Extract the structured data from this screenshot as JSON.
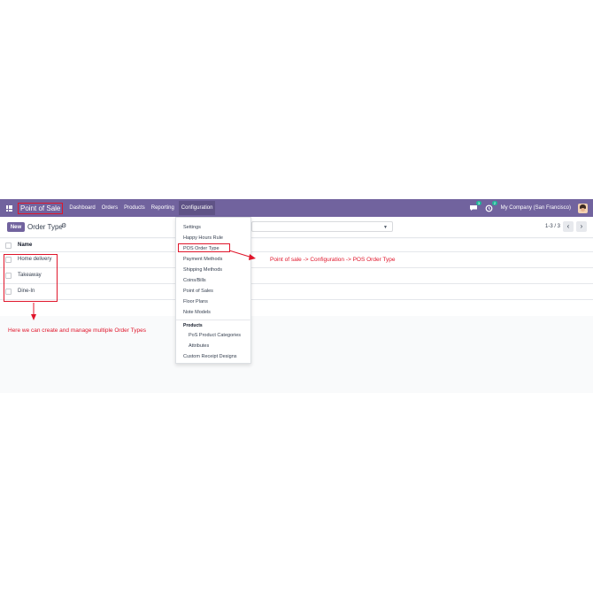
{
  "navbar": {
    "brand": "Point of Sale",
    "menu": [
      "Dashboard",
      "Orders",
      "Products",
      "Reporting",
      "Configuration"
    ],
    "messages_badge": "3",
    "activity_badge": "2",
    "company": "My Company (San Francisco)"
  },
  "control": {
    "new_label": "New",
    "title": "Order Type",
    "pager": "1-3 / 3",
    "prev": "‹",
    "next": "›"
  },
  "list": {
    "column_header": "Name",
    "rows": [
      "Home delivery",
      "Takeaway",
      "Dine-In"
    ]
  },
  "dropdown": {
    "items": [
      "Settings",
      "Happy Hours Rule",
      "POS Order Type",
      "Payment Methods",
      "Shipping Methods",
      "Coins/Bills",
      "Point of Sales",
      "Floor Plans",
      "Note Models"
    ],
    "section": "Products",
    "sub_items": [
      "PoS Product Categories",
      "Attributes"
    ],
    "last_item": "Custom Receipt Designs"
  },
  "annotations": {
    "path": "Point of sale -> Configuration -> POS Order Type",
    "note": "Here we can create and manage multiple Order Types",
    "color": "#e0162b"
  },
  "colors": {
    "navbar": "#71639e",
    "accent_red": "#e0162b",
    "badge": "#21b799"
  }
}
